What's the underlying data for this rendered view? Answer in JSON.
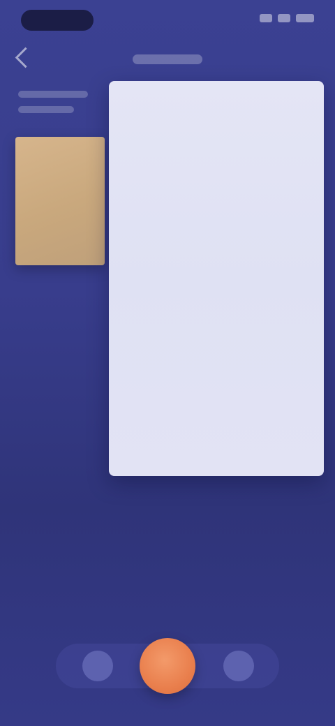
{
  "menu": {
    "items": [
      {
        "label": "",
        "hint": ""
      },
      {
        "label": "",
        "hint": ""
      },
      {
        "label": "",
        "hint": ""
      },
      {
        "label": "",
        "hint": ""
      },
      {
        "label": "",
        "hint": ""
      },
      {
        "label": "",
        "hint": ""
      },
      {
        "label": "",
        "hint": ""
      },
      {
        "label": "",
        "hint": ""
      },
      {
        "label": "",
        "hint": ""
      },
      {
        "label": "",
        "hint": ""
      },
      {
        "label": "",
        "hint": ""
      }
    ]
  },
  "colors": {
    "background": "#3a3f8f",
    "panel": "#e1e2f4",
    "accent": "#e97f4d",
    "cover": "#d2b187"
  },
  "icons": {
    "back": "chevron-left-icon",
    "bottom_left": "circle-button-icon",
    "bottom_center": "primary-action-icon",
    "bottom_right": "circle-button-icon"
  }
}
